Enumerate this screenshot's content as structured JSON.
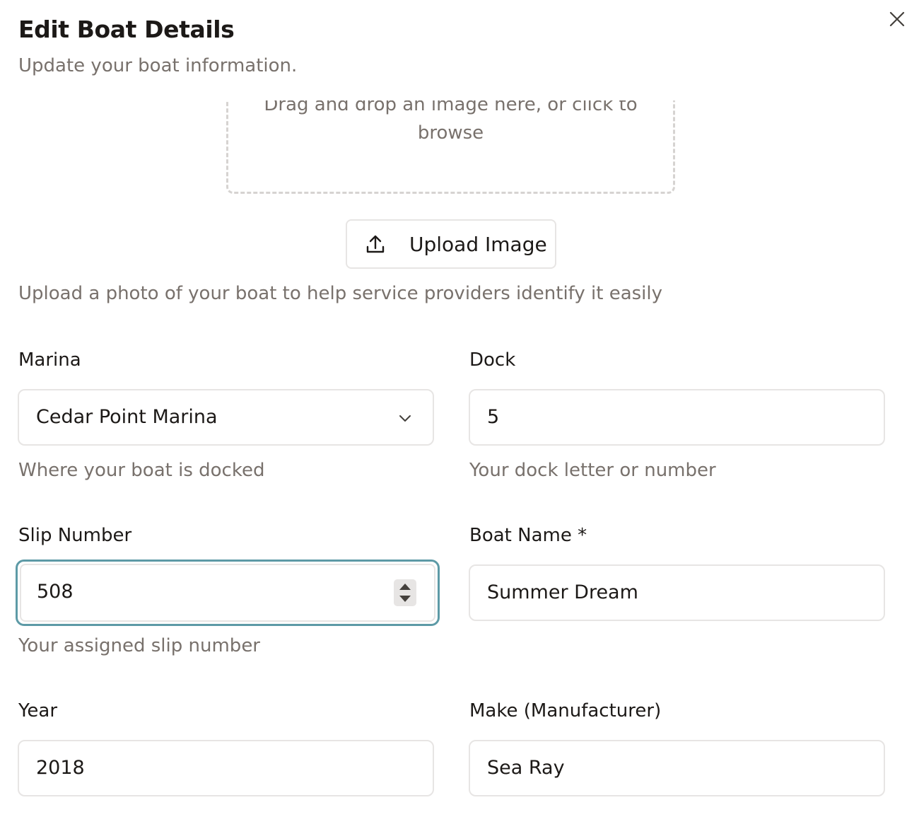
{
  "dialog": {
    "title": "Edit Boat Details",
    "subtitle": "Update your boat information."
  },
  "image_upload": {
    "dropzone_text": "Drag and drop an image here, or click to browse",
    "button_label": "Upload Image",
    "help_text": "Upload a photo of your boat to help service providers identify it easily"
  },
  "fields": {
    "marina": {
      "label": "Marina",
      "value": "Cedar Point Marina",
      "helper": "Where your boat is docked"
    },
    "dock": {
      "label": "Dock",
      "value": "5",
      "helper": "Your dock letter or number"
    },
    "slip_number": {
      "label": "Slip Number",
      "value": "508",
      "helper": "Your assigned slip number"
    },
    "boat_name": {
      "label": "Boat Name *",
      "value": "Summer Dream"
    },
    "year": {
      "label": "Year",
      "value": "2018"
    },
    "make": {
      "label": "Make (Manufacturer)",
      "value": "Sea Ray"
    }
  },
  "icons": {
    "close": "close-icon",
    "upload": "upload-icon",
    "chevron": "chevron-down-icon"
  },
  "colors": {
    "focus_ring": "#5d9aa6",
    "muted_text": "#78716c",
    "border": "#e7e5e4"
  }
}
